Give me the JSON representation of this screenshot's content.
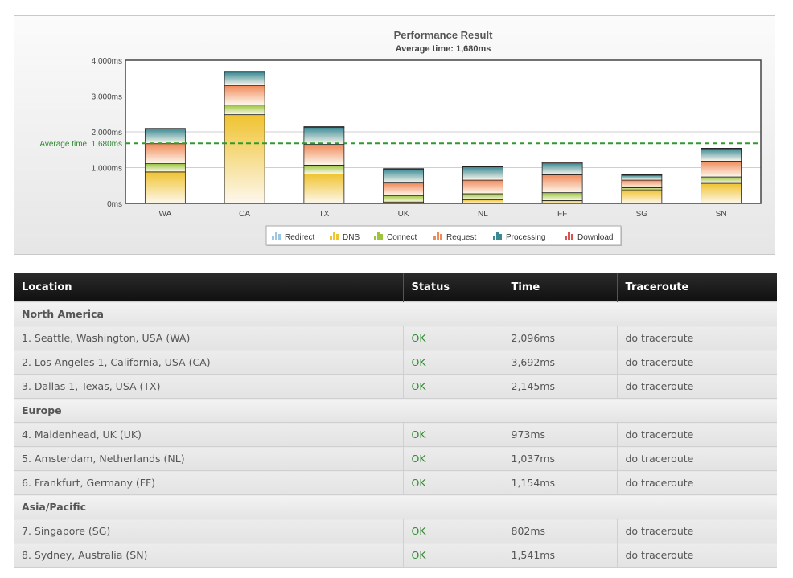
{
  "chart_data": {
    "type": "bar",
    "stacked": true,
    "title": "Performance Result",
    "subtitle": "Average time: 1,680ms",
    "categories": [
      "WA",
      "CA",
      "TX",
      "UK",
      "NL",
      "FF",
      "SG",
      "SN"
    ],
    "y_ticks": [
      "0ms",
      "1,000ms",
      "2,000ms",
      "3,000ms",
      "4,000ms"
    ],
    "ylim": [
      0,
      4000
    ],
    "average_value": 1680,
    "average_label": "Average time: 1,680ms",
    "legend_placement": "bottom-center",
    "series": [
      {
        "name": "Redirect",
        "color": "#9cc7e4",
        "values": [
          0,
          0,
          0,
          0,
          0,
          0,
          0,
          0
        ]
      },
      {
        "name": "DNS",
        "color": "#f0c330",
        "values": [
          880,
          2480,
          820,
          40,
          100,
          80,
          380,
          560
        ]
      },
      {
        "name": "Connect",
        "color": "#9cc53c",
        "values": [
          230,
          270,
          250,
          180,
          170,
          220,
          60,
          180
        ]
      },
      {
        "name": "Request",
        "color": "#f08a5a",
        "values": [
          560,
          540,
          580,
          350,
          380,
          500,
          210,
          440
        ]
      },
      {
        "name": "Processing",
        "color": "#3a8a94",
        "values": [
          420,
          380,
          480,
          390,
          370,
          330,
          140,
          350
        ]
      },
      {
        "name": "Download",
        "color": "#d9534f",
        "values": [
          6,
          22,
          15,
          13,
          17,
          24,
          12,
          11
        ]
      }
    ]
  },
  "table": {
    "headers": [
      "Location",
      "Status",
      "Time",
      "Traceroute"
    ],
    "groups": [
      {
        "name": "North America",
        "rows": [
          {
            "location": "1. Seattle, Washington, USA (WA)",
            "status": "OK",
            "time": "2,096ms",
            "trace": "do traceroute"
          },
          {
            "location": "2. Los Angeles 1, California, USA (CA)",
            "status": "OK",
            "time": "3,692ms",
            "trace": "do traceroute"
          },
          {
            "location": "3. Dallas 1, Texas, USA (TX)",
            "status": "OK",
            "time": "2,145ms",
            "trace": "do traceroute"
          }
        ]
      },
      {
        "name": "Europe",
        "rows": [
          {
            "location": "4. Maidenhead, UK (UK)",
            "status": "OK",
            "time": "973ms",
            "trace": "do traceroute"
          },
          {
            "location": "5. Amsterdam, Netherlands (NL)",
            "status": "OK",
            "time": "1,037ms",
            "trace": "do traceroute"
          },
          {
            "location": "6. Frankfurt, Germany (FF)",
            "status": "OK",
            "time": "1,154ms",
            "trace": "do traceroute"
          }
        ]
      },
      {
        "name": "Asia/Pacific",
        "rows": [
          {
            "location": "7. Singapore (SG)",
            "status": "OK",
            "time": "802ms",
            "trace": "do traceroute"
          },
          {
            "location": "8. Sydney, Australia (SN)",
            "status": "OK",
            "time": "1,541ms",
            "trace": "do traceroute"
          }
        ]
      }
    ]
  }
}
